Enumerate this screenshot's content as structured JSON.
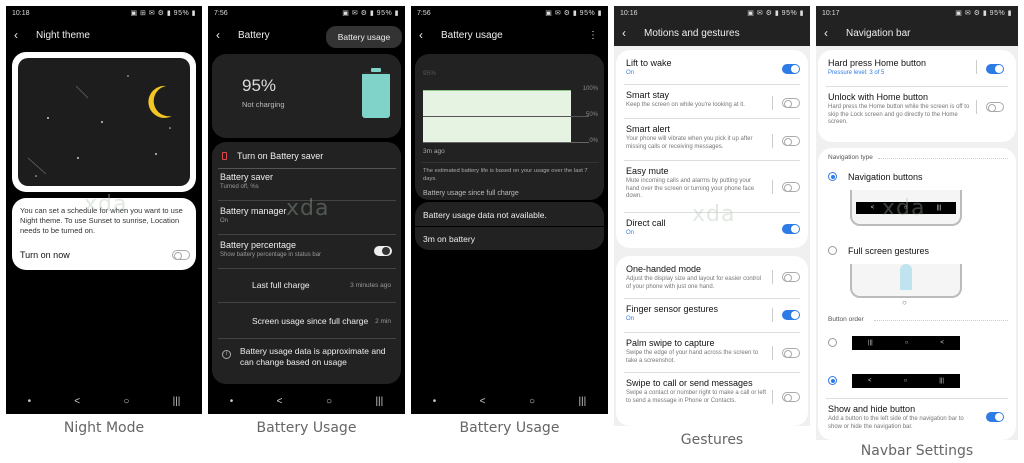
{
  "night": {
    "status_time": "10:18",
    "status_icons": "▣ ⊞ ✉ ⚙ ▮ 95% ▮",
    "title": "Night theme",
    "description": "You can set a schedule for when you want to use Night theme. To use Sunset to sunrise, Location needs to be turned on.",
    "turn_on_label": "Turn on now",
    "caption": "Night Mode"
  },
  "battery": {
    "status_time": "7:56",
    "status_icons": "▣ ✉ ⚙ ▮ 95% ▮",
    "title": "Battery",
    "menu_popup": "Battery usage",
    "percent": "95%",
    "charging": "Not charging",
    "saver_action": "Turn on Battery saver",
    "rows": [
      {
        "title": "Battery saver",
        "sub": "Turned off, %s"
      },
      {
        "title": "Battery manager",
        "sub": "On"
      },
      {
        "title": "Battery percentage",
        "sub": "Show battery percentage in status bar"
      }
    ],
    "last_full_label": "Last full charge",
    "last_full_value": "3 minutes ago",
    "screen_usage_label": "Screen usage since full charge",
    "screen_usage_value": "2 min",
    "info": "Battery usage data is approximate and can change based on usage",
    "caption": "Battery Usage",
    "level_fraction": 0.95
  },
  "usage": {
    "status_time": "7:56",
    "status_icons": "▣ ✉ ⚙ ▮ 95% ▮",
    "title": "Battery usage",
    "graph_start": "95%",
    "axis_100": "100%",
    "axis_50": "50%",
    "axis_0": "0%",
    "time_ago": "3m ago",
    "estimate": "The estimated battery life is based on your usage over the last 7 days.",
    "since_label": "Battery usage since full charge",
    "not_available": "Battery usage data not available.",
    "on_battery": "3m on battery",
    "caption": "Battery Usage"
  },
  "gestures": {
    "status_time": "10:16",
    "status_icons": "▣ ✉ ⚙ ▮ 95% ▮",
    "title": "Motions and gestures",
    "rows1": [
      {
        "title": "Lift to wake",
        "sub": "On",
        "on": true
      },
      {
        "title": "Smart stay",
        "sub": "Keep the screen on while you're looking at it.",
        "on": false
      },
      {
        "title": "Smart alert",
        "sub": "Your phone will vibrate when you pick it up after missing calls or receiving messages.",
        "on": false
      },
      {
        "title": "Easy mute",
        "sub": "Mute incoming calls and alarms by putting your hand over the screen or turning your phone face down.",
        "on": false
      },
      {
        "title": "Direct call",
        "sub": "On",
        "on": true
      }
    ],
    "rows2": [
      {
        "title": "One-handed mode",
        "sub": "Adjust the display size and layout for easier control of your phone with just one hand.",
        "on": false
      },
      {
        "title": "Finger sensor gestures",
        "sub": "On",
        "on": true
      },
      {
        "title": "Palm swipe to capture",
        "sub": "Swipe the edge of your hand across the screen to take a screenshot.",
        "on": false
      },
      {
        "title": "Swipe to call or send messages",
        "sub": "Swipe a contact or number right to make a call or left to send a message in Phone or Contacts.",
        "on": false
      }
    ],
    "caption": "Gestures",
    "watermark": "xda"
  },
  "navbar": {
    "status_time": "10:17",
    "status_icons": "▣ ✉ ⚙ ▮ 95% ▮",
    "title": "Navigation bar",
    "hard_press_title": "Hard press Home button",
    "hard_press_sub": "Pressure level: 3 of 5",
    "unlock_title": "Unlock with Home button",
    "unlock_sub": "Hard press the Home button while the screen is off to skip the Lock screen and go directly to the Home screen.",
    "nav_type_label": "Navigation type",
    "nav_buttons": "Navigation buttons",
    "full_screen": "Full screen gestures",
    "button_order_label": "Button order",
    "order1": [
      "|||",
      "○",
      "<"
    ],
    "order2": [
      "<",
      "○",
      "|||"
    ],
    "show_hide_title": "Show and hide button",
    "show_hide_sub": "Add a button to the left side of the navigation bar to show or hide the navigation bar.",
    "caption": "Navbar Settings"
  },
  "watermark_text": "xda",
  "nav_icons": {
    "back": "<",
    "home": "○",
    "recents": "|||",
    "dot": "•"
  },
  "colors": {
    "accent": "#2f7be5",
    "battery": "#7fd3c8",
    "moon": "#f3c623",
    "saver": "#e0474c"
  }
}
